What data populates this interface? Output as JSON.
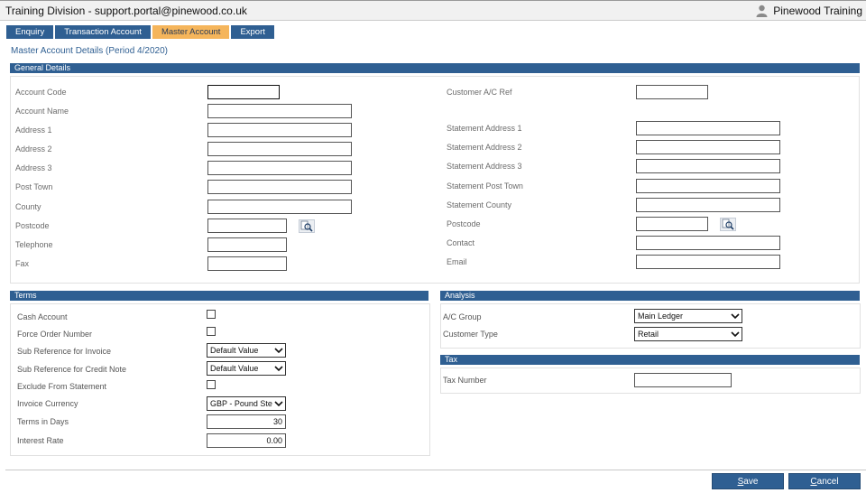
{
  "window": {
    "title": "Training Division - support.portal@pinewood.co.uk",
    "user": "Pinewood Training"
  },
  "tabs": [
    {
      "label": "Enquiry",
      "active": false
    },
    {
      "label": "Transaction Account",
      "active": false
    },
    {
      "label": "Master Account",
      "active": true
    },
    {
      "label": "Export",
      "active": false
    }
  ],
  "page": {
    "subtitle": "Master Account Details (Period 4/2020)"
  },
  "general": {
    "heading": "General Details",
    "left": {
      "account_code": {
        "label": "Account Code",
        "value": ""
      },
      "account_name": {
        "label": "Account Name",
        "value": ""
      },
      "address1": {
        "label": "Address 1",
        "value": ""
      },
      "address2": {
        "label": "Address 2",
        "value": ""
      },
      "address3": {
        "label": "Address 3",
        "value": ""
      },
      "post_town": {
        "label": "Post Town",
        "value": ""
      },
      "county": {
        "label": "County",
        "value": ""
      },
      "postcode": {
        "label": "Postcode",
        "value": ""
      },
      "telephone": {
        "label": "Telephone",
        "value": ""
      },
      "fax": {
        "label": "Fax",
        "value": ""
      }
    },
    "right": {
      "customer_ref": {
        "label": "Customer A/C Ref",
        "value": ""
      },
      "stmt_address1": {
        "label": "Statement Address 1",
        "value": ""
      },
      "stmt_address2": {
        "label": "Statement Address 2",
        "value": ""
      },
      "stmt_address3": {
        "label": "Statement Address 3",
        "value": ""
      },
      "stmt_post_town": {
        "label": "Statement Post Town",
        "value": ""
      },
      "stmt_county": {
        "label": "Statement County",
        "value": ""
      },
      "postcode": {
        "label": "Postcode",
        "value": ""
      },
      "contact": {
        "label": "Contact",
        "value": ""
      },
      "email": {
        "label": "Email",
        "value": ""
      }
    }
  },
  "terms": {
    "heading": "Terms",
    "cash_account": {
      "label": "Cash Account",
      "checked": false
    },
    "force_order": {
      "label": "Force Order Number",
      "checked": false
    },
    "sub_ref_invoice": {
      "label": "Sub Reference for Invoice",
      "value": "Default Value"
    },
    "sub_ref_credit": {
      "label": "Sub Reference for Credit Note",
      "value": "Default Value"
    },
    "exclude_statement": {
      "label": "Exclude From Statement",
      "checked": false
    },
    "invoice_currency": {
      "label": "Invoice Currency",
      "value": "GBP - Pound Ste"
    },
    "terms_days": {
      "label": "Terms in Days",
      "value": "30"
    },
    "interest_rate": {
      "label": "Interest Rate",
      "value": "0.00"
    }
  },
  "analysis": {
    "heading": "Analysis",
    "ac_group": {
      "label": "A/C Group",
      "value": "Main Ledger"
    },
    "customer_type": {
      "label": "Customer Type",
      "value": "Retail"
    }
  },
  "tax": {
    "heading": "Tax",
    "tax_number": {
      "label": "Tax Number",
      "value": ""
    }
  },
  "actions": {
    "save_prefix": "S",
    "save_rest": "ave",
    "cancel_prefix": "C",
    "cancel_rest": "ancel"
  },
  "colors": {
    "accent": "#2f5f92",
    "active_tab": "#f5b55b"
  }
}
